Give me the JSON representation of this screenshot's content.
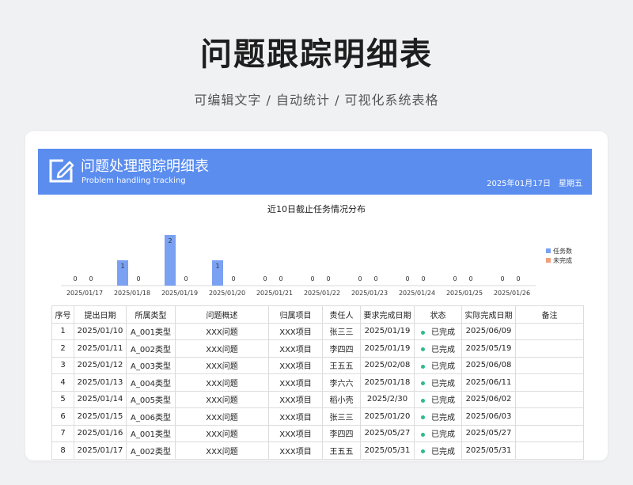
{
  "hero": {
    "title": "问题跟踪明细表",
    "subtitle": "可编辑文字 / 自动统计 / 可视化系统表格"
  },
  "banner": {
    "icon": "edit-icon",
    "title": "问题处理跟踪明细表",
    "subtitle": "Problem handling tracking",
    "date": "2025年01月17日",
    "weekday": "星期五",
    "color": "#5b8def"
  },
  "chart_data": {
    "type": "bar",
    "title": "近10日截止任务情况分布",
    "categories": [
      "2025/01/17",
      "2025/01/18",
      "2025/01/19",
      "2025/01/20",
      "2025/01/21",
      "2025/01/22",
      "2025/01/23",
      "2025/01/24",
      "2025/01/25",
      "2025/01/26"
    ],
    "series": [
      {
        "name": "任务数",
        "values": [
          0,
          1,
          2,
          1,
          0,
          0,
          0,
          0,
          0,
          0
        ],
        "color": "#7ba1f2"
      },
      {
        "name": "未完成",
        "values": [
          0,
          0,
          0,
          0,
          0,
          0,
          0,
          0,
          0,
          0
        ],
        "color": "#f2a07b"
      }
    ],
    "ylim": [
      0,
      2
    ],
    "legend": "right",
    "grid": false
  },
  "table": {
    "headers": [
      "序号",
      "提出日期",
      "所属类型",
      "问题概述",
      "归属项目",
      "责任人",
      "要求完成日期",
      "状态",
      "实际完成日期",
      "备注"
    ],
    "rows": [
      [
        "1",
        "2025/01/10",
        "A_001类型",
        "XXX问题",
        "XXX项目",
        "张三三",
        "2025/01/19",
        "已完成",
        "2025/06/09",
        ""
      ],
      [
        "2",
        "2025/01/11",
        "A_002类型",
        "XXX问题",
        "XXX项目",
        "李四四",
        "2025/01/19",
        "已完成",
        "2025/05/19",
        ""
      ],
      [
        "3",
        "2025/01/12",
        "A_003类型",
        "XXX问题",
        "XXX项目",
        "王五五",
        "2025/02/08",
        "已完成",
        "2025/06/08",
        ""
      ],
      [
        "4",
        "2025/01/13",
        "A_004类型",
        "XXX问题",
        "XXX项目",
        "李六六",
        "2025/01/18",
        "已完成",
        "2025/06/11",
        ""
      ],
      [
        "5",
        "2025/01/14",
        "A_005类型",
        "XXX问题",
        "XXX项目",
        "稻小壳",
        "2025/2/30",
        "已完成",
        "2025/06/02",
        ""
      ],
      [
        "6",
        "2025/01/15",
        "A_006类型",
        "XXX问题",
        "XXX项目",
        "张三三",
        "2025/01/20",
        "已完成",
        "2025/06/03",
        ""
      ],
      [
        "7",
        "2025/01/16",
        "A_001类型",
        "XXX问题",
        "XXX项目",
        "李四四",
        "2025/05/27",
        "已完成",
        "2025/05/27",
        ""
      ],
      [
        "8",
        "2025/01/17",
        "A_002类型",
        "XXX问题",
        "XXX项目",
        "王五五",
        "2025/05/31",
        "已完成",
        "2025/05/31",
        ""
      ]
    ],
    "status_dot_color": "#2dbb8a"
  }
}
